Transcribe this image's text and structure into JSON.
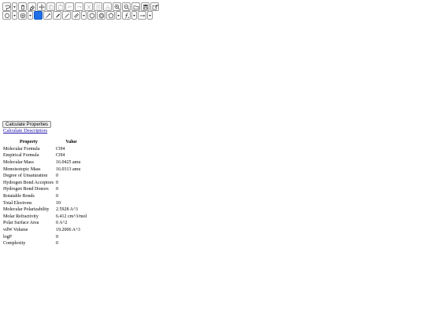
{
  "toolbar": {
    "row1": [
      {
        "icon": "lasso-select-icon",
        "type": "button",
        "interactable": true
      },
      {
        "icon": "chevron-down-icon",
        "type": "dropdown",
        "interactable": true
      },
      {
        "icon": "trash-icon",
        "type": "button",
        "interactable": true
      },
      {
        "icon": "eraser-icon",
        "type": "button",
        "interactable": true
      },
      {
        "icon": "move-icon",
        "type": "button",
        "interactable": true
      },
      {
        "icon": "copy-icon",
        "type": "button",
        "disabled": true,
        "interactable": true
      },
      {
        "icon": "paste-icon",
        "type": "button",
        "disabled": true,
        "interactable": true
      },
      {
        "icon": "undo-icon",
        "type": "button",
        "disabled": true,
        "interactable": true
      },
      {
        "icon": "redo-icon",
        "type": "button",
        "disabled": true,
        "interactable": true
      },
      {
        "icon": "cut-icon",
        "type": "button",
        "disabled": true,
        "interactable": true
      },
      {
        "icon": "clipboard-copy-icon",
        "type": "button",
        "disabled": true,
        "interactable": true
      },
      {
        "icon": "clean-icon",
        "type": "button",
        "disabled": true,
        "interactable": true
      },
      {
        "icon": "zoom-in-icon",
        "type": "button",
        "interactable": true
      },
      {
        "icon": "zoom-out-icon",
        "type": "button",
        "interactable": true
      },
      {
        "icon": "open-folder-icon",
        "type": "button",
        "interactable": true
      },
      {
        "icon": "save-icon",
        "type": "button",
        "interactable": true
      },
      {
        "icon": "export-icon",
        "type": "button",
        "interactable": true
      }
    ],
    "row2": [
      {
        "icon": "charge-icon",
        "type": "button",
        "interactable": true
      },
      {
        "icon": "chevron-down-icon",
        "type": "dropdown",
        "interactable": true
      },
      {
        "icon": "plus-charge-icon",
        "type": "button",
        "interactable": true
      },
      {
        "icon": "chevron-down-icon",
        "type": "dropdown",
        "interactable": true
      },
      {
        "icon": "color-swatch-icon",
        "type": "button",
        "selected": true,
        "interactable": true
      },
      {
        "icon": "arrow-icon",
        "type": "button",
        "interactable": true
      },
      {
        "icon": "pen-icon",
        "type": "button",
        "interactable": true
      },
      {
        "icon": "single-bond-icon",
        "type": "button",
        "interactable": true
      },
      {
        "icon": "double-bond-icon",
        "type": "button",
        "interactable": true
      },
      {
        "icon": "chevron-down-icon",
        "type": "dropdown",
        "interactable": true
      },
      {
        "icon": "hexagon-ring-icon",
        "type": "button",
        "interactable": true
      },
      {
        "icon": "cyclohexane-icon",
        "type": "button",
        "interactable": true
      },
      {
        "icon": "pentagon-ring-icon",
        "type": "button",
        "interactable": true
      },
      {
        "icon": "chevron-down-icon",
        "type": "dropdown",
        "interactable": true
      },
      {
        "icon": "function-icon",
        "type": "button",
        "interactable": true
      },
      {
        "icon": "chevron-down-icon",
        "type": "dropdown",
        "interactable": true
      },
      {
        "icon": "reaction-arrow-icon",
        "type": "button",
        "interactable": true
      },
      {
        "icon": "chevron-down-icon",
        "type": "dropdown",
        "interactable": true
      }
    ]
  },
  "accent_color": "#1e6fe8",
  "calculate_button_label": "Calculate Properties",
  "calculate_descriptors_link": "Calculate Descriptors",
  "table": {
    "headers": [
      "Property",
      "Value"
    ],
    "rows": [
      [
        "Molecular Formula",
        "CH4"
      ],
      [
        "Empirical Formula",
        "CH4"
      ],
      [
        "Molecular Mass",
        "16.0425 amu"
      ],
      [
        "Monoisotopic Mass",
        "16.0313 amu"
      ],
      [
        "Degree of Unsaturation",
        "0"
      ],
      [
        "Hydrogen Bond Acceptors",
        "0"
      ],
      [
        "Hydrogen Bond Donors",
        "0"
      ],
      [
        "Rotatable Bonds",
        "0"
      ],
      [
        "Total Electrons",
        "10"
      ],
      [
        "Molecular Polarizability",
        "2.5928 A^3"
      ],
      [
        "Molar Refractivity",
        "6.412 cm^3/mol"
      ],
      [
        "Polar Surface Area",
        "0 A^2"
      ],
      [
        "vdW Volume",
        "19.2006 A^3"
      ],
      [
        "logP",
        "0"
      ],
      [
        "Complexity",
        "0"
      ]
    ]
  }
}
